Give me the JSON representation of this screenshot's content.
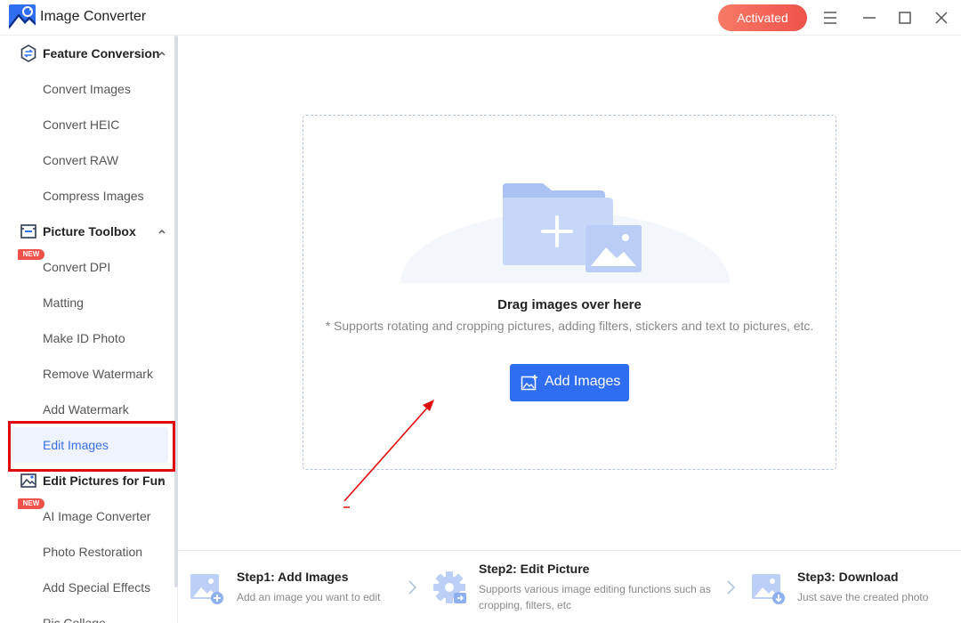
{
  "app": {
    "title": "Image Converter",
    "activated_label": "Activated",
    "accent": "#2f6ef0"
  },
  "sidebar": {
    "sections": [
      {
        "title": "Feature Conversion",
        "icon": "convert-icon",
        "items": [
          {
            "label": "Convert Images"
          },
          {
            "label": "Convert HEIC"
          },
          {
            "label": "Convert RAW"
          },
          {
            "label": "Compress Images"
          }
        ]
      },
      {
        "title": "Picture Toolbox",
        "icon": "toolbox-icon",
        "items": [
          {
            "label": "Convert DPI",
            "badge": "NEW"
          },
          {
            "label": "Matting"
          },
          {
            "label": "Make ID Photo"
          },
          {
            "label": "Remove Watermark"
          },
          {
            "label": "Add Watermark"
          },
          {
            "label": "Edit Images",
            "active": true
          }
        ]
      },
      {
        "title": "Edit Pictures for Fun",
        "icon": "picture-fun-icon",
        "items": [
          {
            "label": "AI Image Converter",
            "badge": "NEW"
          },
          {
            "label": "Photo Restoration"
          },
          {
            "label": "Add Special Effects"
          },
          {
            "label": "Pic Collage"
          }
        ]
      }
    ]
  },
  "main": {
    "drag_title": "Drag images over here",
    "drag_hint": "* Supports rotating and cropping pictures, adding filters, stickers and text to pictures, etc.",
    "add_button_label": "Add Images"
  },
  "steps": [
    {
      "title": "Step1:  Add Images",
      "desc_lines": [
        "Add an image you want to edit"
      ],
      "icon": "image-add-icon"
    },
    {
      "title": "Step2:  Edit Picture",
      "desc_lines": [
        "Supports various image editing functions such as",
        "cropping, filters, etc"
      ],
      "icon": "gear-edit-icon"
    },
    {
      "title": "Step3:  Download",
      "desc_lines": [
        "Just save the created photo"
      ],
      "icon": "image-download-icon"
    }
  ]
}
